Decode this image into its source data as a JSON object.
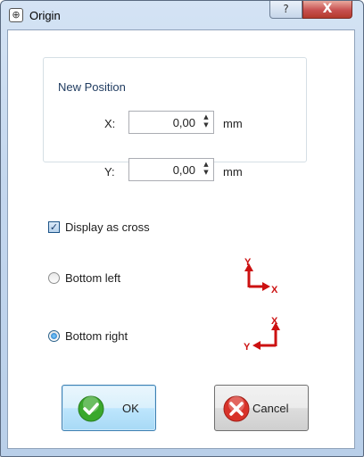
{
  "window": {
    "title": "Origin",
    "help_label": "?",
    "close_label": "X"
  },
  "new_position": {
    "group_title": "New Position",
    "x_label": "X:",
    "x_value": "0,00",
    "x_unit": "mm",
    "y_label": "Y:",
    "y_value": "0,00",
    "y_unit": "mm"
  },
  "display_as_cross": {
    "label": "Display as cross",
    "checked": true
  },
  "origin_options": [
    {
      "label": "Bottom left",
      "selected": false,
      "axis_vertical": "Y",
      "axis_horizontal": "X"
    },
    {
      "label": "Bottom right",
      "selected": true,
      "axis_vertical": "X",
      "axis_horizontal": "Y"
    }
  ],
  "buttons": {
    "ok_label": "OK",
    "cancel_label": "Cancel"
  },
  "colors": {
    "axis_red": "#cc1111",
    "ok_green": "#3aa82c",
    "cancel_red": "#d8332a",
    "accent_blue": "#3c7fb1"
  },
  "icons": {
    "title": "origin-app-icon",
    "ok": "checkmark-icon",
    "cancel": "x-circle-icon"
  }
}
